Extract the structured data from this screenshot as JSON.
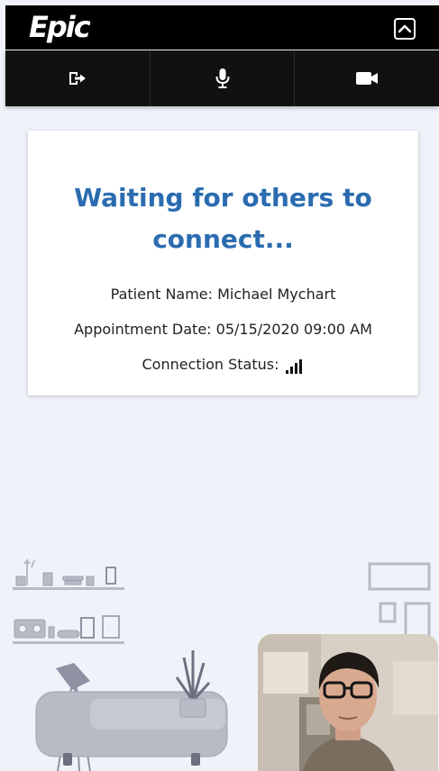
{
  "header": {
    "logo_text": "Epic",
    "collapse_icon": "chevron-up-icon"
  },
  "toolbar": {
    "buttons": [
      {
        "name": "leave-call-button",
        "icon": "exit-icon"
      },
      {
        "name": "microphone-button",
        "icon": "microphone-icon"
      },
      {
        "name": "camera-button",
        "icon": "video-camera-icon"
      }
    ]
  },
  "card": {
    "title": "Waiting for others to connect...",
    "patient_label": "Patient Name:",
    "patient_name": "Michael Mychart",
    "appointment_label": "Appointment Date:",
    "appointment_value": "05/15/2020 09:00 AM",
    "connection_label": "Connection Status:",
    "connection_icon": "signal-bars-icon",
    "title_color": "#2b6cb0"
  },
  "colors": {
    "background": "#eff3f9",
    "header": "#000000",
    "illustration": "#b8bac6"
  }
}
